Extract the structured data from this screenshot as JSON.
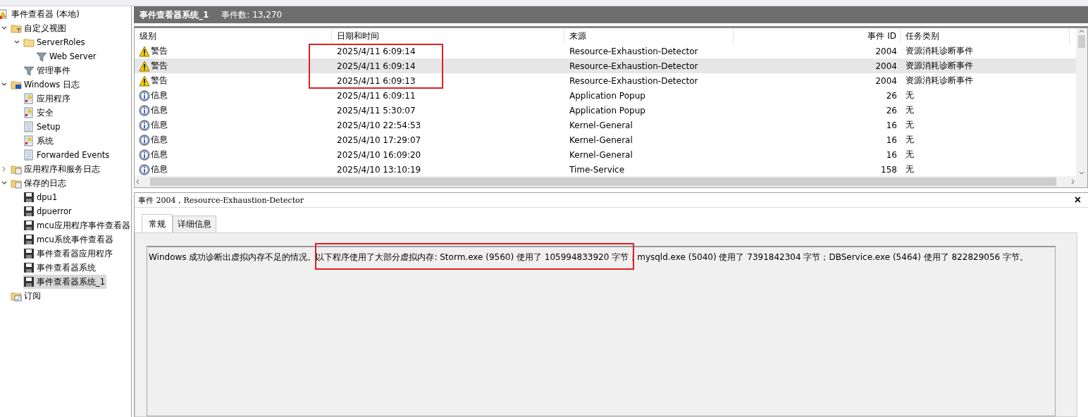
{
  "tree": [
    {
      "label": "事件查看器 (本地)",
      "kind": "root",
      "selected": false,
      "children": [
        {
          "label": "自定义视图",
          "kind": "folder-filter",
          "expanded": true,
          "selected": false,
          "children": [
            {
              "label": "ServerRoles",
              "kind": "folder",
              "expanded": true,
              "selected": false,
              "children": [
                {
                  "label": "Web Server",
                  "kind": "filter",
                  "selected": false
                }
              ]
            },
            {
              "label": "管理事件",
              "kind": "filter",
              "selected": false
            }
          ]
        },
        {
          "label": "Windows 日志",
          "kind": "windows-folder",
          "expanded": true,
          "selected": false,
          "children": [
            {
              "label": "应用程序",
              "kind": "log-warn",
              "selected": false
            },
            {
              "label": "安全",
              "kind": "log-warn",
              "selected": false
            },
            {
              "label": "Setup",
              "kind": "log",
              "selected": false
            },
            {
              "label": "系统",
              "kind": "log-warn",
              "selected": false
            },
            {
              "label": "Forwarded Events",
              "kind": "log",
              "selected": false
            }
          ]
        },
        {
          "label": "应用程序和服务日志",
          "kind": "folder-log",
          "expanded": false,
          "selected": false
        },
        {
          "label": "保存的日志",
          "kind": "folder-log",
          "expanded": true,
          "selected": false,
          "children": [
            {
              "label": "dpu1",
              "kind": "saved",
              "selected": false
            },
            {
              "label": "dpuerror",
              "kind": "saved",
              "selected": false
            },
            {
              "label": "mcu应用程序事件查看器",
              "kind": "saved",
              "selected": false
            },
            {
              "label": "mcu系统事件查看器",
              "kind": "saved",
              "selected": false
            },
            {
              "label": "事件查看器应用程序",
              "kind": "saved",
              "selected": false
            },
            {
              "label": "事件查看器系统",
              "kind": "saved",
              "selected": false
            },
            {
              "label": "事件查看器系统_1",
              "kind": "saved",
              "selected": true
            }
          ]
        },
        {
          "label": "订阅",
          "kind": "subscription",
          "selected": false
        }
      ]
    }
  ],
  "log_header": {
    "title": "事件查看器系统_1",
    "count": "事件数: 13,270"
  },
  "table": {
    "columns": [
      "级别",
      "日期和时间",
      "来源",
      "事件 ID",
      "任务类别"
    ],
    "rows": [
      {
        "kind": "warning",
        "level": "警告",
        "datetime": "2025/4/11 6:09:14",
        "source": "Resource-Exhaustion-Detector",
        "event_id": "2004",
        "category": "资源消耗诊断事件",
        "selected": false,
        "highlighted": true
      },
      {
        "kind": "warning",
        "level": "警告",
        "datetime": "2025/4/11 6:09:14",
        "source": "Resource-Exhaustion-Detector",
        "event_id": "2004",
        "category": "资源消耗诊断事件",
        "selected": true,
        "highlighted": true
      },
      {
        "kind": "warning",
        "level": "警告",
        "datetime": "2025/4/11 6:09:13",
        "source": "Resource-Exhaustion-Detector",
        "event_id": "2004",
        "category": "资源消耗诊断事件",
        "selected": false,
        "highlighted": true
      },
      {
        "kind": "info",
        "level": "信息",
        "datetime": "2025/4/11 6:09:11",
        "source": "Application Popup",
        "event_id": "26",
        "category": "无",
        "selected": false,
        "highlighted": false
      },
      {
        "kind": "info",
        "level": "信息",
        "datetime": "2025/4/11 5:30:07",
        "source": "Application Popup",
        "event_id": "26",
        "category": "无",
        "selected": false,
        "highlighted": false
      },
      {
        "kind": "info",
        "level": "信息",
        "datetime": "2025/4/10 22:54:53",
        "source": "Kernel-General",
        "event_id": "16",
        "category": "无",
        "selected": false,
        "highlighted": false
      },
      {
        "kind": "info",
        "level": "信息",
        "datetime": "2025/4/10 17:29:07",
        "source": "Kernel-General",
        "event_id": "16",
        "category": "无",
        "selected": false,
        "highlighted": false
      },
      {
        "kind": "info",
        "level": "信息",
        "datetime": "2025/4/10 16:09:20",
        "source": "Kernel-General",
        "event_id": "16",
        "category": "无",
        "selected": false,
        "highlighted": false
      },
      {
        "kind": "info",
        "level": "信息",
        "datetime": "2025/4/10 13:10:19",
        "source": "Time-Service",
        "event_id": "158",
        "category": "无",
        "selected": false,
        "highlighted": false
      }
    ]
  },
  "detail": {
    "title": "事件 2004，Resource-Exhaustion-Detector",
    "close": "×",
    "tabs": [
      {
        "label": "常规",
        "selected": true
      },
      {
        "label": "详细信息",
        "selected": false
      }
    ],
    "message": "Windows 成功诊断出虚拟内存不足的情况。以下程序使用了大部分虚拟内存: Storm.exe (9560) 使用了 105994833920 字节；mysqld.exe (5040) 使用了 7391842304 字节；DBService.exe (5464) 使用了 822829056 字节。",
    "message_highlighted": true
  }
}
